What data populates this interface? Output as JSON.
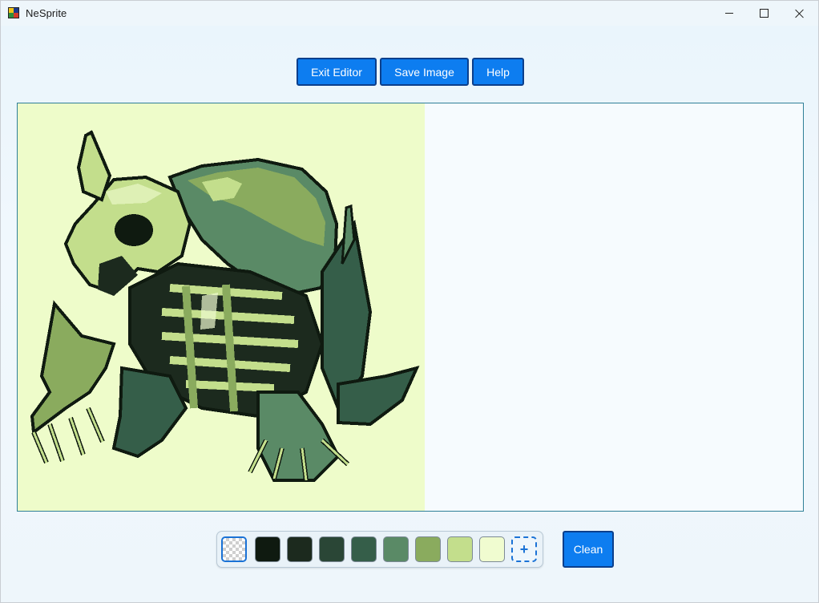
{
  "window": {
    "title": "NeSprite",
    "icon": "nesprite-app-icon",
    "controls": [
      "minimize-icon",
      "maximize-icon",
      "close-icon"
    ]
  },
  "toolbar": {
    "exit_label": "Exit Editor",
    "save_label": "Save Image",
    "help_label": "Help"
  },
  "editor": {
    "sprite_background": "#eefcca",
    "canvas_background": "#f6fbfe"
  },
  "palette": {
    "swatches": [
      {
        "name": "transparent",
        "color": "transparent",
        "selected": true
      },
      {
        "name": "color-1",
        "color": "#0f1a10"
      },
      {
        "name": "color-2",
        "color": "#1c2a1e"
      },
      {
        "name": "color-3",
        "color": "#2a4636"
      },
      {
        "name": "color-4",
        "color": "#355e49"
      },
      {
        "name": "color-5",
        "color": "#5a8a66"
      },
      {
        "name": "color-6",
        "color": "#8aab5e"
      },
      {
        "name": "color-7",
        "color": "#c3de8c"
      },
      {
        "name": "color-8",
        "color": "#f0fcd0"
      }
    ],
    "add_label": "+"
  },
  "actions": {
    "clean_label": "Clean"
  },
  "colors": {
    "accent": "#0d7df0",
    "accent_border": "#0b3f8c",
    "selection": "#1a72d6"
  }
}
